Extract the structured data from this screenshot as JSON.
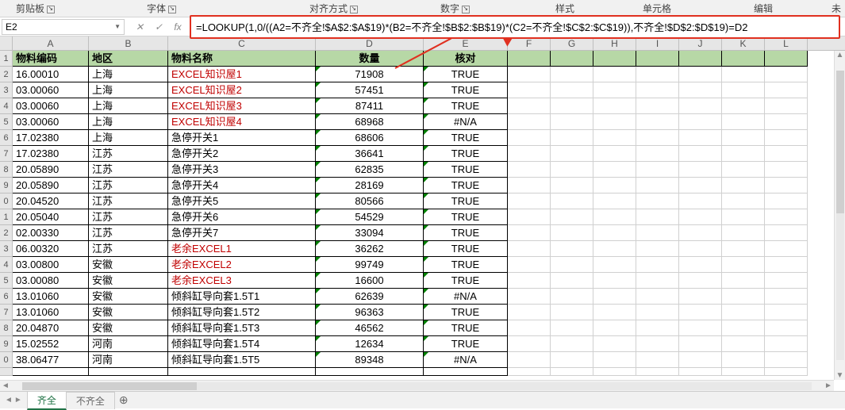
{
  "ribbon": {
    "groups": [
      "剪贴板",
      "字体",
      "对齐方式",
      "数字",
      "样式",
      "单元格",
      "编辑"
    ],
    "extra": "未"
  },
  "namebox": "E2",
  "fx": {
    "cancel": "✕",
    "confirm": "✓",
    "fx": "fx"
  },
  "formula": "=LOOKUP(1,0/((A2=不齐全!$A$2:$A$19)*(B2=不齐全!$B$2:$B$19)*(C2=不齐全!$C$2:$C$19)),不齐全!$D$2:$D$19)=D2",
  "cols": [
    "A",
    "B",
    "C",
    "D",
    "E",
    "F",
    "G",
    "H",
    "I",
    "J",
    "K",
    "L"
  ],
  "header": {
    "A": "物料编码",
    "B": "地区",
    "C": "物料名称",
    "D": "数量",
    "E": "核对"
  },
  "rows": [
    {
      "n": "2",
      "A": "16.00010",
      "B": "上海",
      "C": "EXCEL知识屋1",
      "Cred": true,
      "D": "71908",
      "E": "TRUE"
    },
    {
      "n": "3",
      "A": "03.00060",
      "B": "上海",
      "C": "EXCEL知识屋2",
      "Cred": true,
      "D": "57451",
      "E": "TRUE"
    },
    {
      "n": "4",
      "A": "03.00060",
      "B": "上海",
      "C": "EXCEL知识屋3",
      "Cred": true,
      "D": "87411",
      "E": "TRUE"
    },
    {
      "n": "5",
      "A": "03.00060",
      "B": "上海",
      "C": "EXCEL知识屋4",
      "Cred": true,
      "D": "68968",
      "E": "#N/A"
    },
    {
      "n": "6",
      "A": "17.02380",
      "B": "上海",
      "C": "急停开关1",
      "Cred": false,
      "D": "68606",
      "E": "TRUE"
    },
    {
      "n": "7",
      "A": "17.02380",
      "B": "江苏",
      "C": "急停开关2",
      "Cred": false,
      "D": "36641",
      "E": "TRUE"
    },
    {
      "n": "8",
      "A": "20.05890",
      "B": "江苏",
      "C": "急停开关3",
      "Cred": false,
      "D": "62835",
      "E": "TRUE"
    },
    {
      "n": "9",
      "A": "20.05890",
      "B": "江苏",
      "C": "急停开关4",
      "Cred": false,
      "D": "28169",
      "E": "TRUE"
    },
    {
      "n": "0",
      "A": "20.04520",
      "B": "江苏",
      "C": "急停开关5",
      "Cred": false,
      "D": "80566",
      "E": "TRUE"
    },
    {
      "n": "1",
      "A": "20.05040",
      "B": "江苏",
      "C": "急停开关6",
      "Cred": false,
      "D": "54529",
      "E": "TRUE"
    },
    {
      "n": "2",
      "A": "02.00330",
      "B": "江苏",
      "C": "急停开关7",
      "Cred": false,
      "D": "33094",
      "E": "TRUE"
    },
    {
      "n": "3",
      "A": "06.00320",
      "B": "江苏",
      "C": "老余EXCEL1",
      "Cred": true,
      "D": "36262",
      "E": "TRUE"
    },
    {
      "n": "4",
      "A": "03.00800",
      "B": "安徽",
      "C": "老余EXCEL2",
      "Cred": true,
      "D": "99749",
      "E": "TRUE"
    },
    {
      "n": "5",
      "A": "03.00080",
      "B": "安徽",
      "C": "老余EXCEL3",
      "Cred": true,
      "D": "16600",
      "E": "TRUE"
    },
    {
      "n": "6",
      "A": "13.01060",
      "B": "安徽",
      "C": "倾斜缸导向套1.5T1",
      "Cred": false,
      "D": "62639",
      "E": "#N/A"
    },
    {
      "n": "7",
      "A": "13.01060",
      "B": "安徽",
      "C": "倾斜缸导向套1.5T2",
      "Cred": false,
      "D": "96363",
      "E": "TRUE"
    },
    {
      "n": "8",
      "A": "20.04870",
      "B": "安徽",
      "C": "倾斜缸导向套1.5T3",
      "Cred": false,
      "D": "46562",
      "E": "TRUE"
    },
    {
      "n": "9",
      "A": "15.02552",
      "B": "河南",
      "C": "倾斜缸导向套1.5T4",
      "Cred": false,
      "D": "12634",
      "E": "TRUE"
    },
    {
      "n": "0",
      "A": "38.06477",
      "B": "河南",
      "C": "倾斜缸导向套1.5T5",
      "Cred": false,
      "D": "89348",
      "E": "#N/A"
    }
  ],
  "tabs": {
    "nav": [
      "◄",
      "►"
    ],
    "sheets": [
      {
        "name": "齐全",
        "active": true
      },
      {
        "name": "不齐全",
        "active": false
      }
    ],
    "add": "⊕"
  }
}
